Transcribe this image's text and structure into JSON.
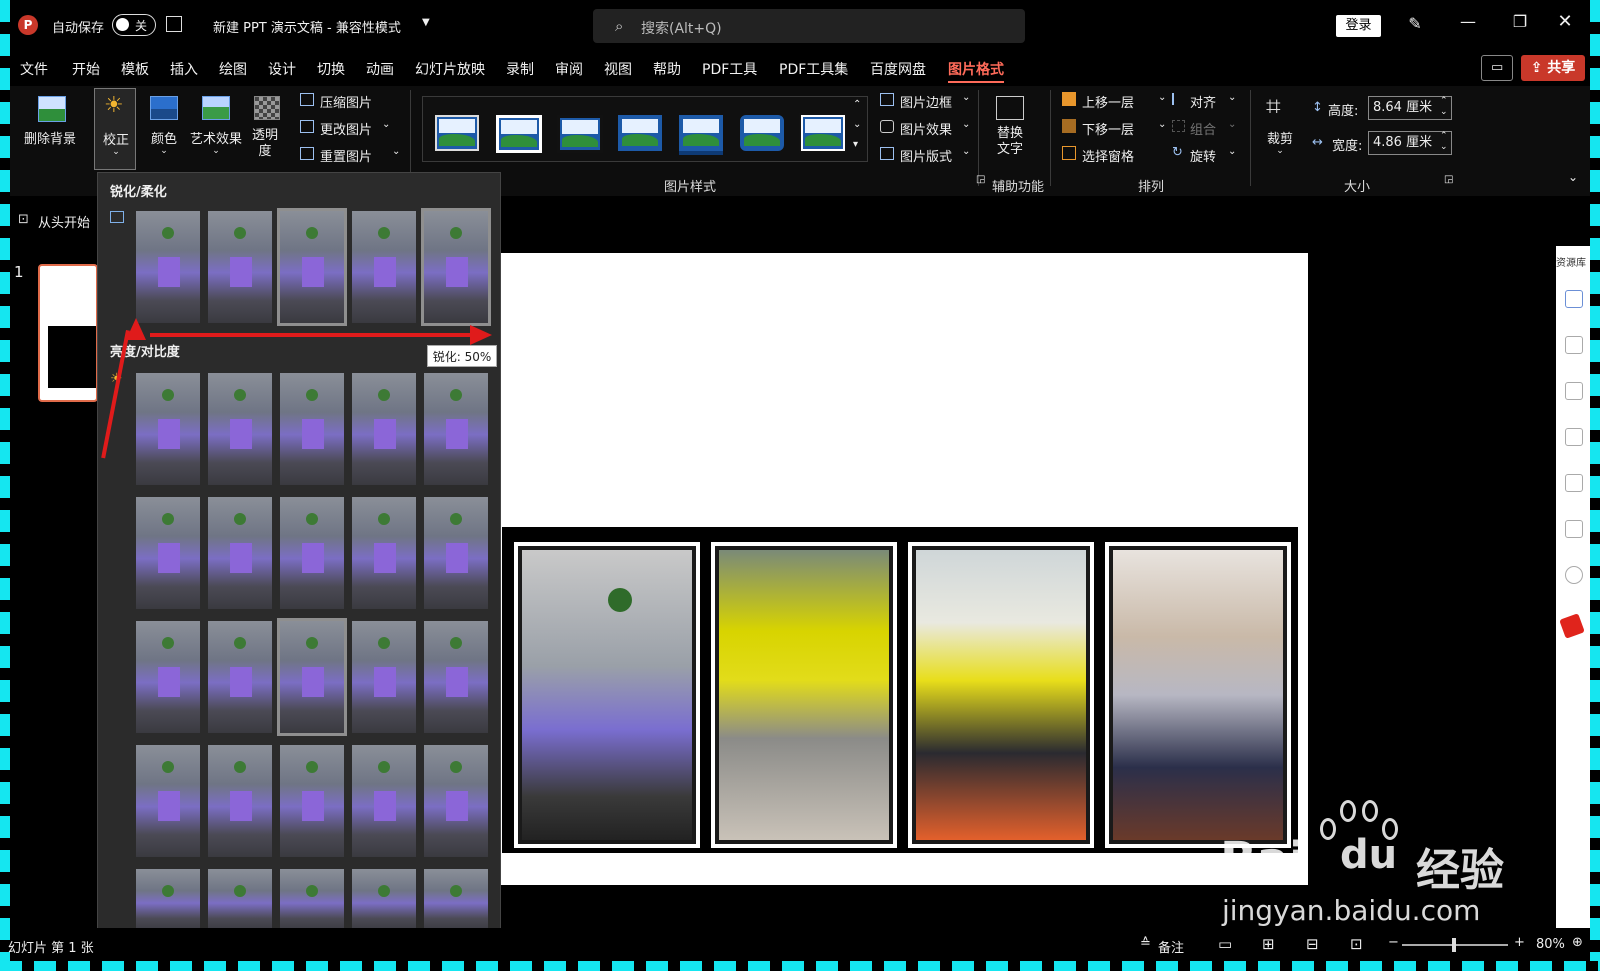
{
  "titlebar": {
    "autosave_label": "自动保存",
    "toggle_state": "关",
    "doc_title": "新建 PPT 演示文稿  -  兼容性模式",
    "search_placeholder": "搜索(Alt+Q)",
    "login_label": "登录"
  },
  "menu": {
    "items": [
      "文件",
      "开始",
      "模板",
      "插入",
      "绘图",
      "设计",
      "切换",
      "动画",
      "幻灯片放映",
      "录制",
      "审阅",
      "视图",
      "帮助",
      "PDF工具",
      "PDF工具集",
      "百度网盘",
      "图片格式"
    ],
    "active": "图片格式",
    "share_label": "共享"
  },
  "ribbon": {
    "remove_bg": "删除背景",
    "correct": "校正",
    "color": "颜色",
    "art_effect": "艺术效果",
    "transparency": "透明度",
    "compress": "压缩图片",
    "change_pic": "更改图片",
    "reset_pic": "重置图片",
    "styles_group": "图片样式",
    "pic_border": "图片边框",
    "pic_effect": "图片效果",
    "pic_layout": "图片版式",
    "alt_text": "替换文字",
    "accessibility_group": "辅助功能",
    "bring_forward": "上移一层",
    "send_backward": "下移一层",
    "selection_pane": "选择窗格",
    "align": "对齐",
    "group": "组合",
    "rotate": "旋转",
    "arrange_group": "排列",
    "crop": "裁剪",
    "height_label": "高度:",
    "height_value": "8.64 厘米",
    "width_label": "宽度:",
    "width_value": "4.86 厘米",
    "size_group": "大小"
  },
  "slideshow_from_start": "从头开始",
  "gallery": {
    "section1": "锐化/柔化",
    "section2": "亮度/对比度",
    "tooltip": "锐化: 50%"
  },
  "slide_number": "1",
  "right_pane": {
    "title": "资源库"
  },
  "status": {
    "slide_info": "幻灯片 第 1 张",
    "notes": "备注",
    "zoom": "80%"
  },
  "watermark": {
    "brand": "Bai",
    "brand2": "du",
    "cn": "经验",
    "url": "jingyan.baidu.com"
  },
  "colors": {
    "accent": "#ff6b5a",
    "share": "#c9382a",
    "frame": "#15e6f0",
    "arrow": "#e01b1b"
  }
}
